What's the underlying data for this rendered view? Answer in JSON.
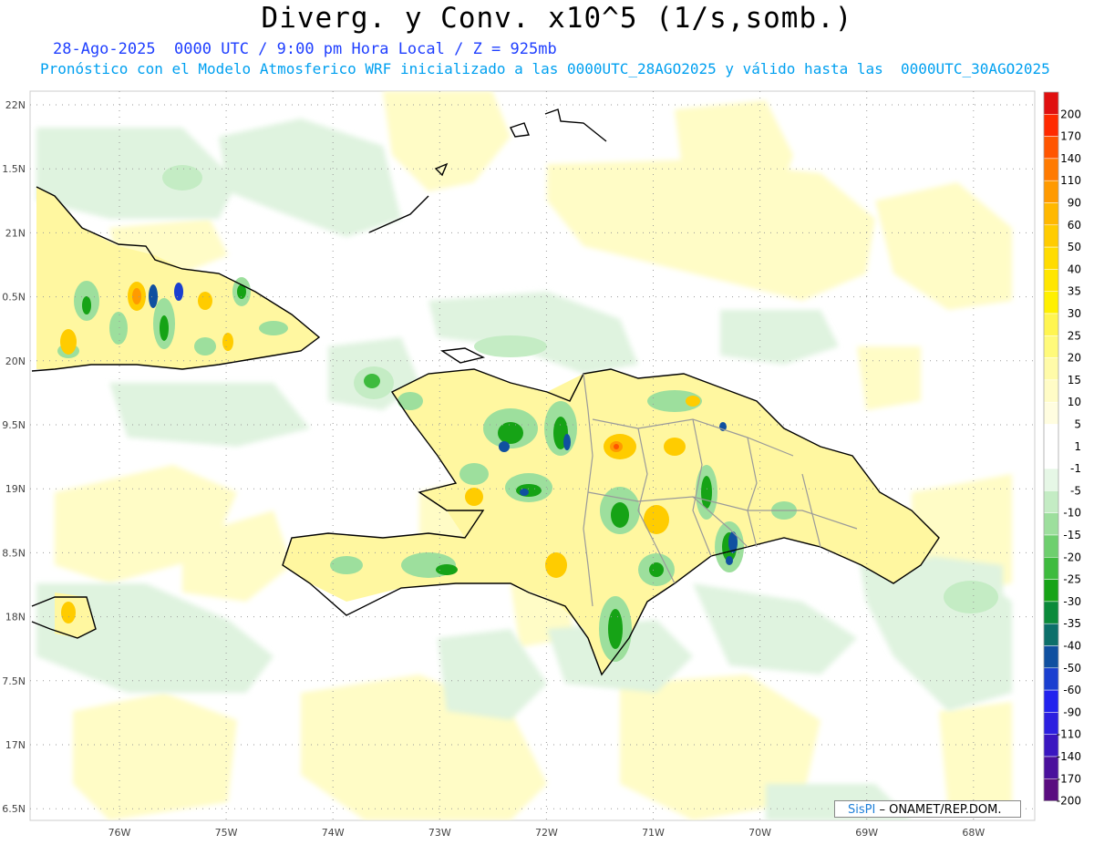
{
  "header": {
    "title": "Diverg. y Conv. x10^5 (1/s,somb.)",
    "subtitle_line1": "28-Ago-2025  0000 UTC / 9:00 pm Hora Local / Z = 925mb",
    "subtitle_line2": "Pronóstico con el Modelo Atmosferico WRF inicializado a las 0000UTC_28AGO2025 y válido hasta las  0000UTC_30AGO2025"
  },
  "map": {
    "lat_labels": [
      "22N",
      "1.5N",
      "21N",
      "0.5N",
      "20N",
      "9.5N",
      "19N",
      "8.5N",
      "18N",
      "7.5N",
      "17N",
      "6.5N"
    ],
    "lon_labels": [
      "76W",
      "75W",
      "74W",
      "73W",
      "72W",
      "71W",
      "70W",
      "69W",
      "68W"
    ]
  },
  "colorbar": {
    "labels": [
      "200",
      "170",
      "140",
      "110",
      "90",
      "60",
      "50",
      "40",
      "35",
      "30",
      "25",
      "20",
      "15",
      "10",
      "5",
      "1",
      "-1",
      "-5",
      "-10",
      "-15",
      "-20",
      "-25",
      "-30",
      "-35",
      "-40",
      "-50",
      "-60",
      "-90",
      "-110",
      "-140",
      "-170",
      "-200"
    ],
    "colors": [
      "#e01010",
      "#ff2a00",
      "#ff5500",
      "#ff7a00",
      "#ff9a00",
      "#ffb800",
      "#ffcc00",
      "#ffdc00",
      "#ffe600",
      "#fff000",
      "#fff550",
      "#fffa7a",
      "#fffba8",
      "#fffcc6",
      "#fffde0",
      "#ffffff",
      "#ffffff",
      "#e6f7e6",
      "#c4ecc4",
      "#9ddf9d",
      "#6ecf6e",
      "#3ebb3e",
      "#16a316",
      "#0a8a3a",
      "#0c6f6a",
      "#1050a0",
      "#1a3fd0",
      "#2222ee",
      "#2c1fe0",
      "#3a16c0",
      "#4a109c",
      "#5a0c80"
    ]
  },
  "watermark": {
    "brand": "SisPI",
    "org": "– ONAMET/REP.DOM."
  }
}
